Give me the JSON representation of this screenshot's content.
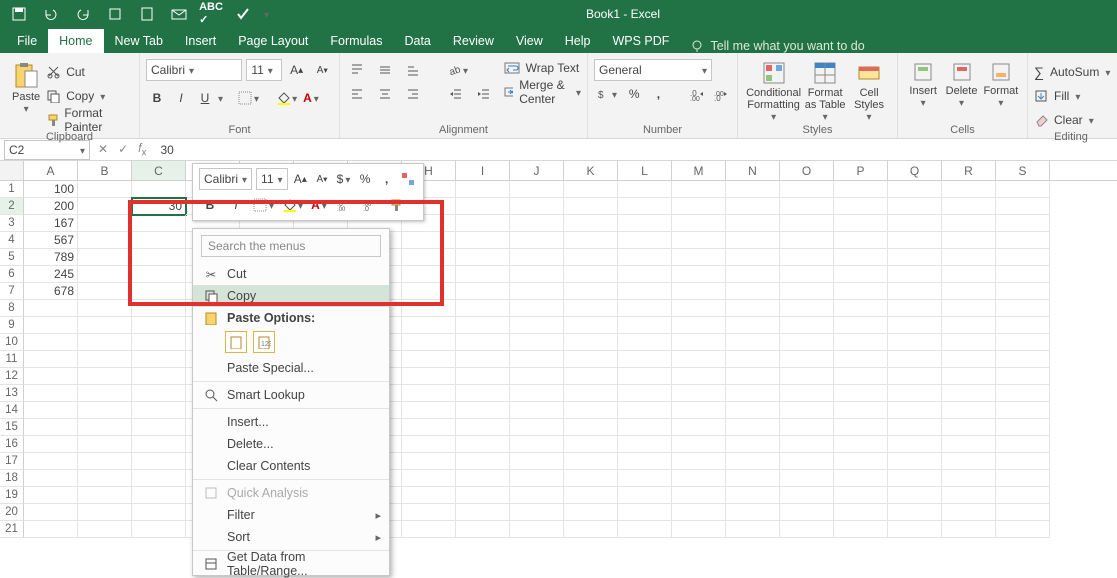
{
  "title": "Book1  -  Excel",
  "qat_icons": [
    "save-icon",
    "undo-icon",
    "redo-icon",
    "touch-icon",
    "new-icon",
    "email-icon",
    "spellcheck-icon",
    "check-icon"
  ],
  "tabs": [
    "File",
    "Home",
    "New Tab",
    "Insert",
    "Page Layout",
    "Formulas",
    "Data",
    "Review",
    "View",
    "Help",
    "WPS PDF"
  ],
  "active_tab": "Home",
  "tellme": "Tell me what you want to do",
  "ribbon": {
    "clipboard": {
      "label": "Clipboard",
      "paste": "Paste",
      "cut": "Cut",
      "copy": "Copy",
      "painter": "Format Painter"
    },
    "font": {
      "label": "Font",
      "name": "Calibri",
      "size": "11"
    },
    "alignment": {
      "label": "Alignment",
      "wrap": "Wrap Text",
      "merge": "Merge & Center"
    },
    "number": {
      "label": "Number",
      "format": "General"
    },
    "styles": {
      "label": "Styles",
      "cond": "Conditional Formatting",
      "table": "Format as Table",
      "cell": "Cell Styles"
    },
    "cells": {
      "label": "Cells",
      "insert": "Insert",
      "delete": "Delete",
      "format": "Format"
    },
    "editing": {
      "label": "Editing",
      "autosum": "AutoSum",
      "fill": "Fill",
      "clear": "Clear"
    }
  },
  "mini": {
    "font": "Calibri",
    "size": "11",
    "pct": "%"
  },
  "namebox": "C2",
  "formula": "30",
  "columns": [
    "A",
    "B",
    "C",
    "D",
    "E",
    "F",
    "G",
    "H",
    "I",
    "J",
    "K",
    "L",
    "M",
    "N",
    "O",
    "P",
    "Q",
    "R",
    "S"
  ],
  "cells": {
    "A1": "100",
    "A2": "200",
    "A3": "167",
    "A4": "567",
    "A5": "789",
    "A6": "245",
    "A7": "678",
    "C2": "30"
  },
  "selected": "C2",
  "context_menu": {
    "search": "Search the menus",
    "cut": "Cut",
    "copy": "Copy",
    "paste_opts": "Paste Options:",
    "paste_special": "Paste Special...",
    "smart": "Smart Lookup",
    "insert": "Insert...",
    "delete": "Delete...",
    "clear": "Clear Contents",
    "quick": "Quick Analysis",
    "filter": "Filter",
    "sort": "Sort",
    "getdata": "Get Data from Table/Range..."
  }
}
